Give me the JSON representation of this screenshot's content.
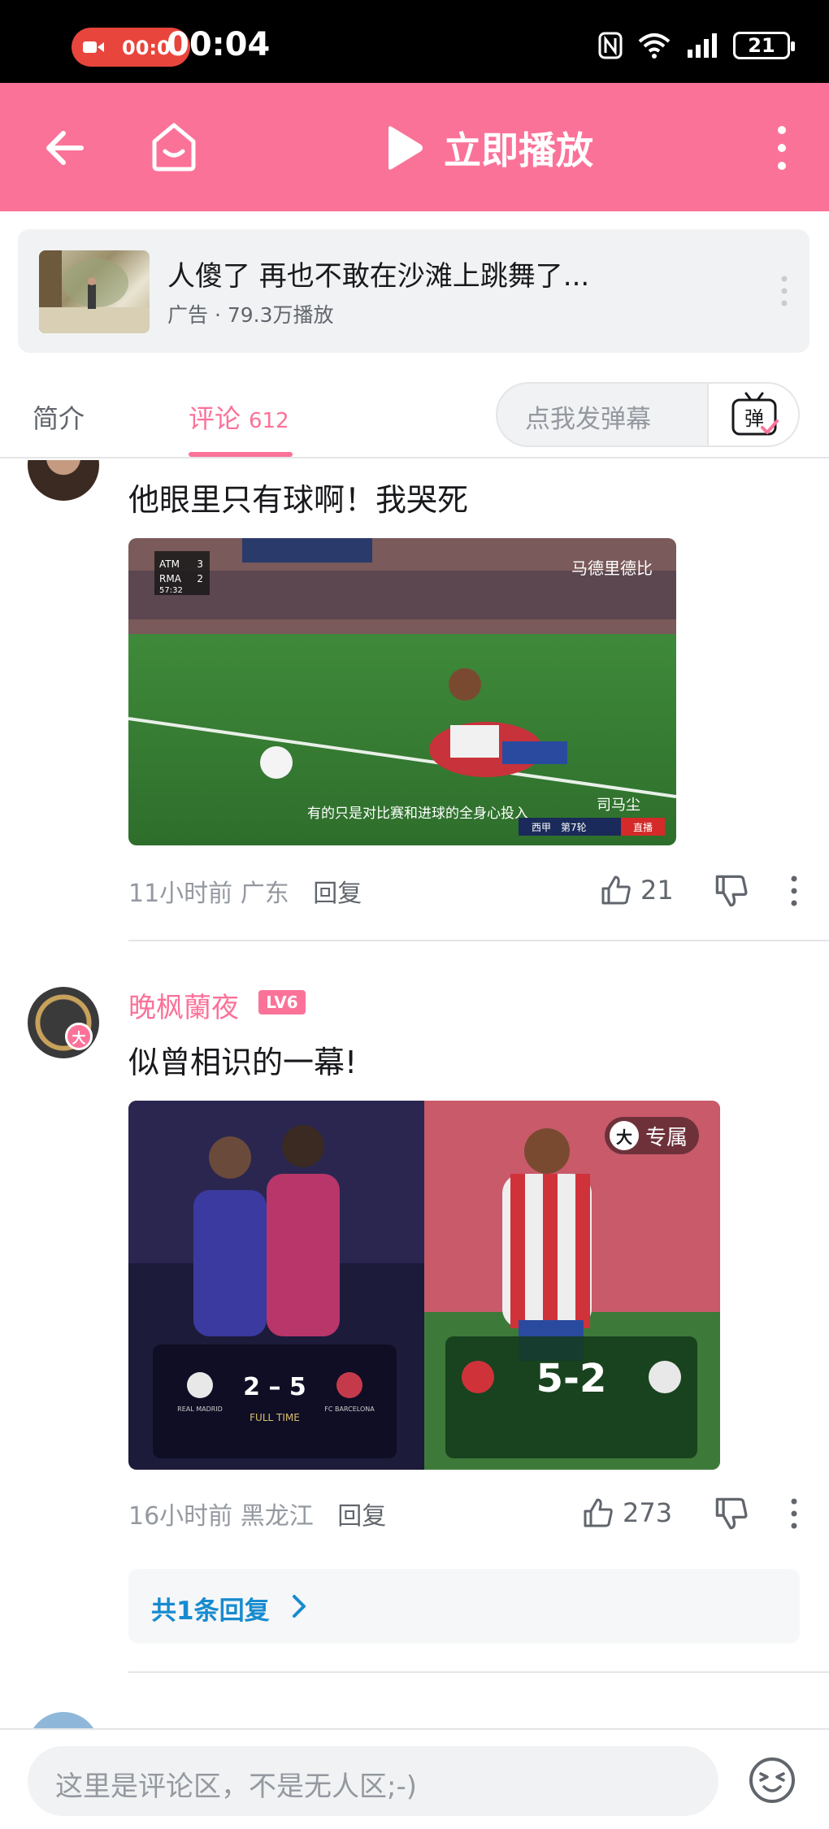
{
  "status_bar": {
    "record_time": "00:0",
    "clock": "00:04",
    "battery": "21",
    "icons": [
      "nfc-icon",
      "wifi-icon",
      "signal-icon",
      "battery-icon"
    ]
  },
  "header": {
    "play_label": "立即播放",
    "background": "#fb7299"
  },
  "ad": {
    "title": "人傻了 再也不敢在沙滩上跳舞了...",
    "meta": "广告 · 79.3万播放"
  },
  "tabs": {
    "intro": "简介",
    "comments": "评论",
    "comment_count": "612",
    "danmaku_placeholder": "点我发弹幕",
    "danmaku_button": "弹"
  },
  "comments": [
    {
      "text": "他眼里只有球啊！我哭死",
      "image": {
        "score_home": "ATM",
        "score_home_goals": "3",
        "score_away": "RMA",
        "score_away_goals": "2",
        "clock": "57:32",
        "subtitle": "有的只是对比赛和进球的全身心投入",
        "speaker": "司马尘",
        "league": "西甲　第7轮",
        "live": "直播",
        "overlay_name": "马德里德比"
      },
      "time": "11小时前",
      "location": "广东",
      "reply": "回复",
      "likes": "21"
    },
    {
      "user": "晚枫蘭夜",
      "level": "LV6",
      "avatar_badge": "大",
      "text": "似曾相识的一幕!",
      "image": {
        "exclusive_badge": "大",
        "exclusive_label": "专属",
        "left_score": "2 – 5",
        "right_score": "5-2",
        "full_time": "FULL TIME",
        "left_home": "REAL MADRID",
        "left_away": "FC BARCELONA"
      },
      "time": "16小时前",
      "location": "黑龙江",
      "reply": "回复",
      "likes": "273",
      "replies_label": "共1条回复"
    }
  ],
  "bottom": {
    "input_placeholder": "这里是评论区，不是无人区;-)"
  },
  "colors": {
    "accent": "#fb7299",
    "link": "#178bcf",
    "muted": "#9499a0"
  }
}
